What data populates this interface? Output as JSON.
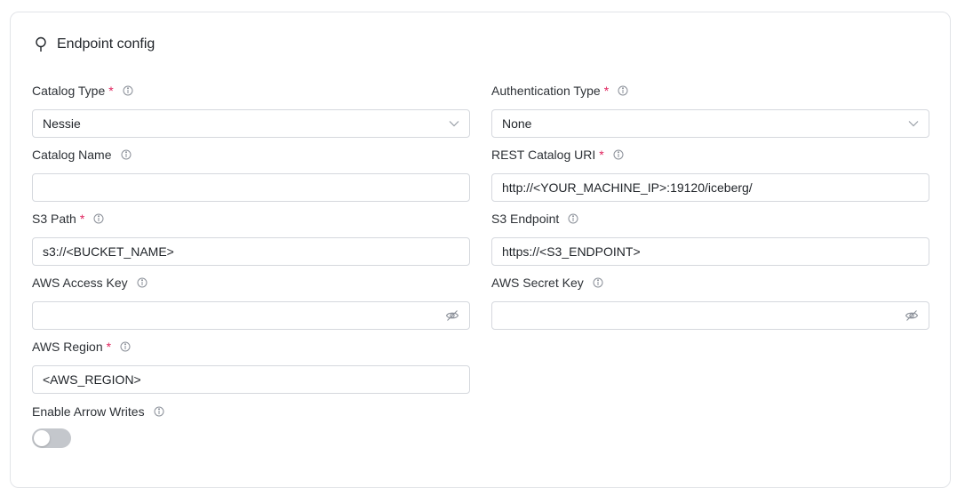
{
  "card": {
    "title": "Endpoint config",
    "icon": "pin-icon"
  },
  "fields": {
    "catalog_type": {
      "label": "Catalog Type",
      "required_mark": "*",
      "value": "Nessie"
    },
    "authentication_type": {
      "label": "Authentication Type",
      "required_mark": "*",
      "value": "None"
    },
    "catalog_name": {
      "label": "Catalog Name",
      "value": ""
    },
    "rest_catalog_uri": {
      "label": "REST Catalog URI",
      "required_mark": "*",
      "value": "http://<YOUR_MACHINE_IP>:19120/iceberg/"
    },
    "s3_path": {
      "label": "S3 Path",
      "required_mark": "*",
      "value": "s3://<BUCKET_NAME>"
    },
    "s3_endpoint": {
      "label": "S3 Endpoint",
      "value": "https://<S3_ENDPOINT>"
    },
    "aws_access_key": {
      "label": "AWS Access Key",
      "value": ""
    },
    "aws_secret_key": {
      "label": "AWS Secret Key",
      "value": ""
    },
    "aws_region": {
      "label": "AWS Region",
      "required_mark": "*",
      "value": "<AWS_REGION>"
    },
    "enable_arrow_writes": {
      "label": "Enable Arrow Writes",
      "enabled": false
    }
  },
  "colors": {
    "required": "#e0245e",
    "border": "#d5d8dd",
    "toggle_off": "#c4c7cc"
  }
}
